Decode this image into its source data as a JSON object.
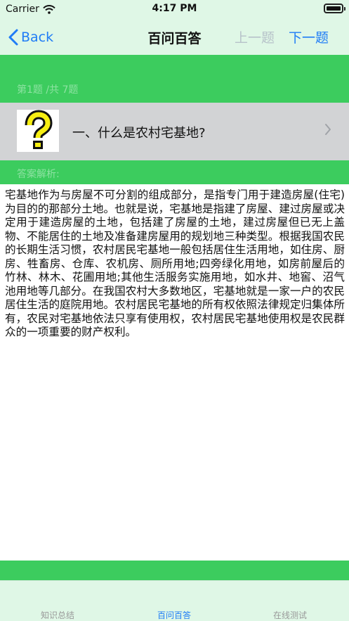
{
  "status_bar": {
    "carrier": "Carrier",
    "time": "4:17 PM"
  },
  "nav": {
    "back_label": "Back",
    "title": "百问百答",
    "prev_label": "上一题",
    "next_label": "下一题"
  },
  "progress": "第1题 /共 7题",
  "question": {
    "text": "一、什么是农村宅基地?"
  },
  "answer_label": "答案解析:",
  "answer_text": "宅基地作为与房屋不可分割的组成部分，是指专门用于建造房屋(住宅)为目的的那部分土地。也就是说，宅基地是指建了房屋、建过房屋或决定用于建造房屋的土地，包括建了房屋的土地，建过房屋但已无上盖物、不能居住的土地及准备建房屋用的规划地三种类型。根据我国农民的长期生活习惯，农村居民宅基地一般包括居住生活用地，如住房、厨房、牲畜房、仓库、农机房、厕所用地;四旁绿化用地，如房前屋后的竹林、林木、花圃用地;其他生活服务实施用地，如水井、地窖、沼气池用地等几部分。在我国农村大多数地区，宅基地就是一家一户的农民居住生活的庭院用地。农村居民宅基地的所有权依照法律规定归集体所有，农民对宅基地依法只享有使用权，农村居民宅基地使用权是农民群众的一项重要的财产权利。",
  "tabs": [
    {
      "label": "知识总结"
    },
    {
      "label": "百问百答"
    },
    {
      "label": "在线测试"
    }
  ],
  "colors": {
    "accent": "#1f7cf6",
    "green": "#3ccc5e",
    "pale_green": "#dff7e6",
    "question_bg": "#d2d3d5"
  }
}
